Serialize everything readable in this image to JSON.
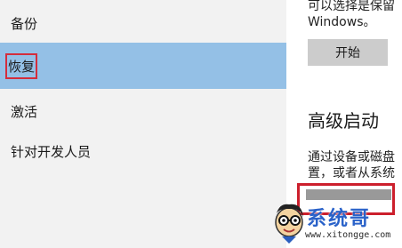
{
  "sidebar": {
    "items": [
      {
        "label": "备份"
      },
      {
        "label": "恢复"
      },
      {
        "label": "激活"
      },
      {
        "label": "针对开发人员"
      }
    ]
  },
  "content": {
    "desc_line1": "可以选择是保留",
    "desc_line2": "Windows。",
    "start_button": "开始",
    "advanced_title": "高级启动",
    "advanced_desc_line1": "通过设备或磁盘",
    "advanced_desc_line2": "置，或者从系统"
  },
  "watermark": {
    "brand": "系统哥",
    "url": "www.xitongge.com"
  }
}
